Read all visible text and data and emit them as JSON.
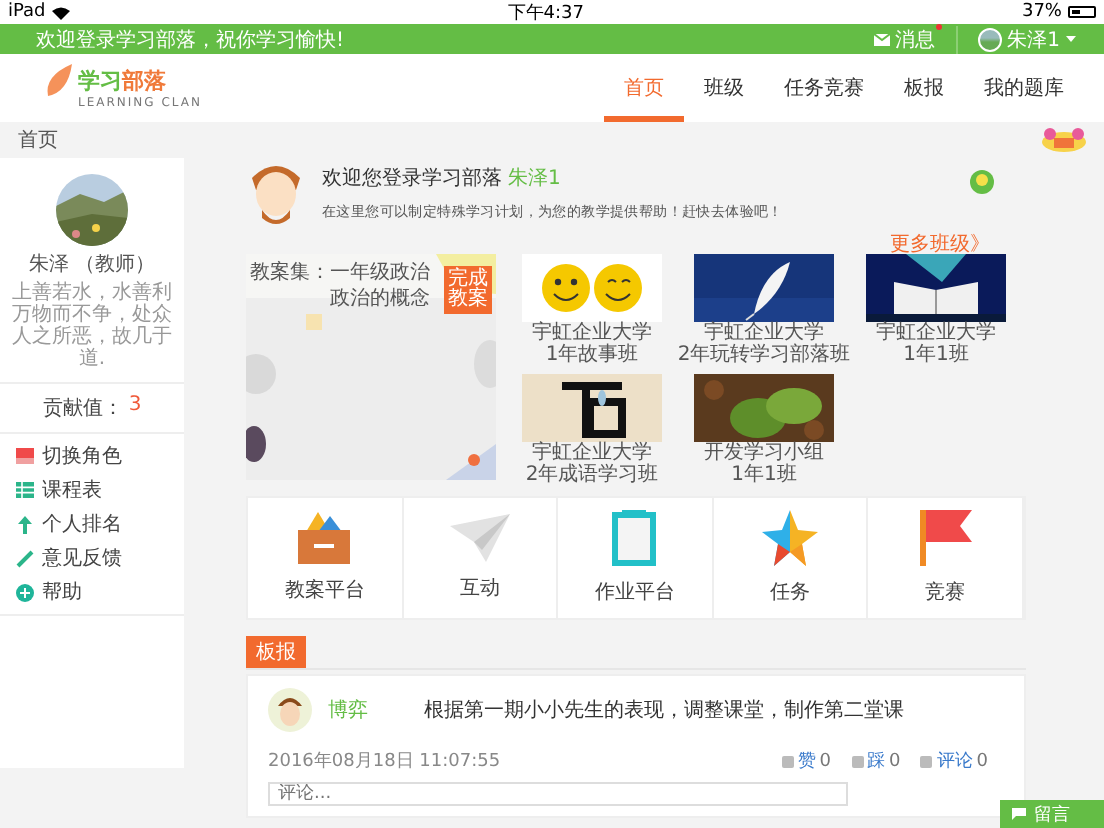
{
  "status_bar": {
    "device": "iPad",
    "time": "下午4:37",
    "battery": "37%"
  },
  "top_bar": {
    "greeting": "欢迎登录学习部落，祝你学习愉快!",
    "messages": {
      "label": "消息",
      "unread": true
    },
    "user": "朱泽1"
  },
  "header": {
    "logo": {
      "title_a": "学习",
      "title_b": "部落",
      "subtitle": "LEARNING CLAN"
    },
    "nav": [
      {
        "label": "首页",
        "selected": true
      },
      {
        "label": "班级",
        "selected": false
      },
      {
        "label": "任务竞赛",
        "selected": false
      },
      {
        "label": "板报",
        "selected": false
      },
      {
        "label": "我的题库",
        "selected": false
      }
    ]
  },
  "breadcrumb": "首页",
  "sidebar": {
    "name": "朱泽 （教师）",
    "motto": "上善若水，水善利万物而不争，处众人之所恶，故几于道.",
    "contribution_label": "贡献值：",
    "contribution": "3",
    "menu": [
      {
        "label": "切换角色"
      },
      {
        "label": "课程表"
      },
      {
        "label": "个人排名"
      },
      {
        "label": "意见反馈"
      },
      {
        "label": "帮助"
      }
    ]
  },
  "welcome": {
    "title": "欢迎您登录学习部落",
    "user": "朱泽1",
    "subtitle": "在这里您可以制定特殊学习计划，为您的教学提供帮助！赶快去体验吧！"
  },
  "lesson": {
    "set": "教案集：一年级政治",
    "topic": "政治的概念",
    "button": "完成教案"
  },
  "more_classes": "更多班级》",
  "classes": [
    {
      "school": "宇虹企业大学",
      "name": "1年故事班"
    },
    {
      "school": "宇虹企业大学",
      "name": "2年玩转学习部落班"
    },
    {
      "school": "宇虹企业大学",
      "name": "1年1班"
    },
    {
      "school": "宇虹企业大学",
      "name": "2年成语学习班"
    },
    {
      "school": "开发学习小组",
      "name": "1年1班"
    }
  ],
  "tiles": [
    {
      "label": "教案平台"
    },
    {
      "label": "互动"
    },
    {
      "label": "作业平台"
    },
    {
      "label": "任务"
    },
    {
      "label": "竞赛"
    }
  ],
  "board_tab": "板报",
  "post": {
    "author": "博弈",
    "text": "根据第一期小小先生的表现，调整课堂，制作第二堂课",
    "date": "2016年08月18日 11:07:55",
    "actions": [
      {
        "label": "赞",
        "count": "0"
      },
      {
        "label": "踩",
        "count": "0"
      },
      {
        "label": "评论",
        "count": "0"
      }
    ],
    "comment_placeholder": "评论..."
  },
  "message_button": "留言"
}
